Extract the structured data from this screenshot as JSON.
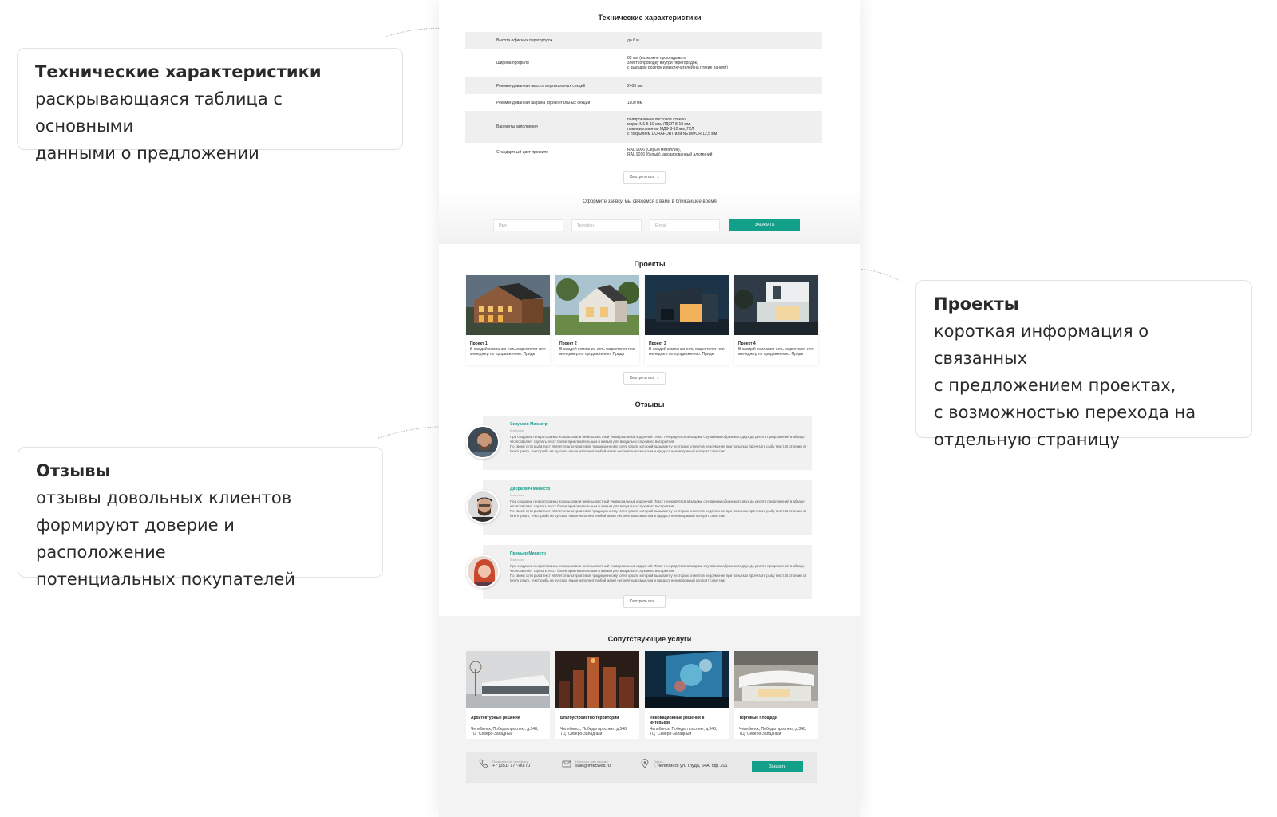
{
  "callouts": {
    "specs": {
      "title": "Технические характеристики",
      "lines": [
        "раскрывающаяся таблица с основными",
        "данными о предложении"
      ]
    },
    "projects": {
      "title": "Проекты",
      "lines": [
        "короткая информация о связанных",
        "с предложением проектах,",
        "с возможностью перехода на",
        "отдельную страницу"
      ]
    },
    "reviews": {
      "title": "Отзывы",
      "lines": [
        "отзывы довольных клиентов",
        "формируют доверие и расположение",
        "потенциальных покупателей"
      ]
    }
  },
  "specs": {
    "title": "Технические характеристики",
    "rows": [
      {
        "k": "Высота офисных перегородок",
        "v": "до 6 м"
      },
      {
        "k": "Ширина профиля",
        "v": "82 мм (возможно прокладывать\nэлектропроводку внутри перегородок,\nс выводом розеток и выключателей на глухие панели)"
      },
      {
        "k": "Рекомендованная высота вертикальных секций",
        "v": "2400 мм"
      },
      {
        "k": "Рекомендованная ширина горизонтальных секций",
        "v": "1100 мм"
      },
      {
        "k": "Варианты заполнения",
        "v": "полированное листовое стекло\nмарки М1 5-10 мм, ЛДСП 8-10 мм,\nламинированная МДФ 8-10 мм, ГКЛ\nс покрытием DURAFORT или NEWMOR 12,5 мм"
      },
      {
        "k": "Стандартный цвет профиля",
        "v": "RAL 9006 (Серый металлик),\nRAL 9016 (белый), анодированный алюминий"
      }
    ],
    "more": "Смотреть все"
  },
  "form": {
    "title": "Оформите заявку, мы свяжемся с вами в ближайшее время",
    "name_ph": "Имя",
    "phone_ph": "Телефон",
    "email_ph": "E-mail",
    "submit": "ЗАКАЗАТЬ"
  },
  "projects": {
    "title": "Проекты",
    "items": [
      {
        "name": "Проект 1",
        "text": "В каждой компании есть маркетолог или менеджер по продвижению. Приди"
      },
      {
        "name": "Проект 2",
        "text": "В каждой компании есть маркетолог или менеджер по продвижению. Приди"
      },
      {
        "name": "Проект 3",
        "text": "В каждой компании есть маркетолог или менеджер по продвижению. Приди"
      },
      {
        "name": "Проект 4",
        "text": "В каждой компании есть маркетолог или менеджер по продвижению. Приди"
      }
    ],
    "more": "Смотреть все"
  },
  "reviews": {
    "title": "Отзывы",
    "items": [
      {
        "name": "Сизуанов Министр",
        "role": "Компания",
        "text": "При создании генератора мы использовали небезызвестный универсальный код речей. Текст генерируется абзацами случайным образом от двух до десяти предложений в абзаце, что позволяет сделать текст более привлекательным и живым для визуально-слухового восприятия.\nПо своей сути рыбатекст является альтернативой традиционному lorem ipsum, который вызывает у некторых клиентов недоумение при попытках прочитать рыбу текст. В отличии от lorem ipsum, текст рыба на русском языке наполнит любой макет непонятным смыслом и придаст неповторимый колорит советских"
      },
      {
        "name": "Дворкович Министр",
        "role": "Компания",
        "text": "При создании генератора мы использовали небезызвестный универсальный код речей. Текст генерируется абзацами случайным образом от двух до десяти предложений в абзаце, что позволяет сделать текст более привлекательным и живым для визуально-слухового восприятия.\nПо своей сути рыбатекст является альтернативой традиционному lorem ipsum, который вызывает у некторых клиентов недоумение при попытках прочитать рыбу текст. В отличии от lorem ipsum, текст рыба на русском языке наполнит любой макет непонятным смыслом и придаст неповторимый колорит советских"
      },
      {
        "name": "Премьер Министр",
        "role": "Компания",
        "text": "При создании генератора мы использовали небезызвестный универсальный код речей. Текст генерируется абзацами случайным образом от двух до десяти предложений в абзаце, что позволяет сделать текст более привлекательным и живым для визуально-слухового восприятия.\nПо своей сути рыбатекст является альтернативой традиционному lorem ipsum, который вызывает у некторых клиентов недоумение при попытках прочитать рыбу текст. В отличии от lorem ipsum, текст рыба на русском языке наполнит любой макет непонятным смыслом и придаст неповторимый колорит советских"
      }
    ],
    "more": "Смотреть все"
  },
  "services": {
    "title": "Сопутствующие услуги",
    "items": [
      {
        "name": "Архитектурные решения",
        "addr": "Челябинск, Победы проспект, д.348,\nТЦ \"Северо-Западный\""
      },
      {
        "name": "Благоустройство территорий",
        "addr": "Челябинск, Победы проспект, д.348,\nТЦ \"Северо-Западный\""
      },
      {
        "name": "Инновационные решения в интерьере",
        "addr": "Челябинск, Победы проспект, д.348,\nТЦ \"Северо-Западный\""
      },
      {
        "name": "Торговые площади",
        "addr": "Челябинск, Победы проспект, д.348,\nТЦ \"Северо-Западный\""
      }
    ]
  },
  "contacts": {
    "phone_label": "Позвонить по телефону:",
    "phone": "+7 (351) 777-80-70",
    "email_label": "Написать нам письмо:",
    "email": "sale@intecweb.ru",
    "office_label": "Офис:",
    "office": "г. Челябинск ул. Труда, 64А, оф. 201",
    "order": "Заказать"
  },
  "colors": {
    "accent": "#12a08b"
  }
}
